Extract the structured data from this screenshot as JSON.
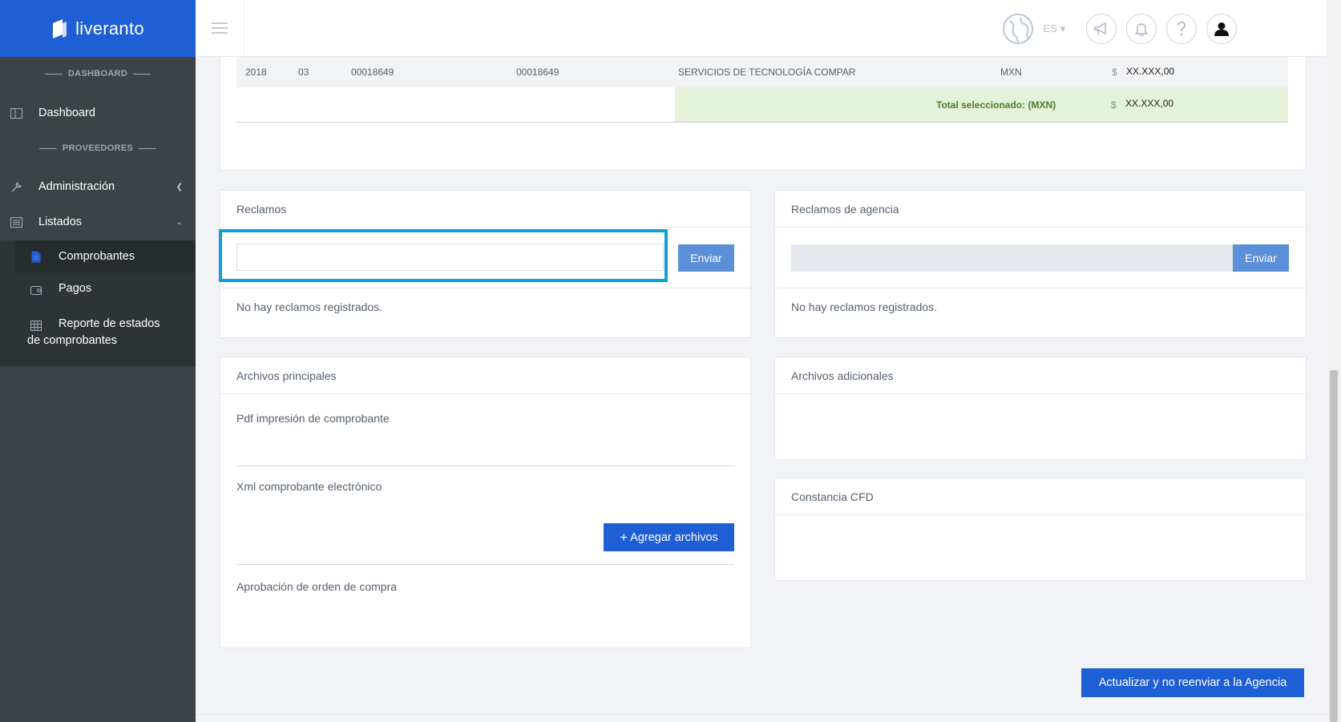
{
  "brand": {
    "name": "liveranto",
    "color": "#1f5fd6",
    "icon": "liveranto-logo-icon"
  },
  "sidebar": {
    "section_dashboard": "DASHBOARD",
    "section_proveedores": "PROVEEDORES",
    "items": [
      {
        "label": "Dashboard",
        "icon": "columns-icon"
      },
      {
        "label": "Administración",
        "icon": "wrench-icon"
      },
      {
        "label": "Listados",
        "icon": "list-icon"
      }
    ],
    "sub_items": [
      {
        "label": "Comprobantes",
        "icon": "document-icon",
        "active": true
      },
      {
        "label": "Pagos",
        "icon": "wallet-icon"
      },
      {
        "label": "Reporte de estados",
        "label2": "de comprobantes",
        "icon": "grid-icon"
      }
    ]
  },
  "topbar": {
    "language": "ES",
    "icons": [
      "globe-icon",
      "megaphone-icon",
      "bell-icon",
      "help-icon",
      "user-icon"
    ]
  },
  "table": {
    "row": {
      "year": "2018",
      "month": "03",
      "folio": "00018649",
      "folio2": "00018649",
      "provider": "SERVICIOS DE TECNOLOGÍA COMPAR",
      "currency": "MXN",
      "symbol": "$",
      "amount": "XX.XXX,00"
    },
    "total": {
      "label": "Total seleccionado: (MXN)",
      "symbol": "$",
      "amount": "XX.XXX,00"
    }
  },
  "reclamos": {
    "title": "Reclamos",
    "send_label": "Enviar",
    "empty_text": "No hay reclamos registrados.",
    "input_value": ""
  },
  "reclamos_agencia": {
    "title": "Reclamos de agencia",
    "send_label": "Enviar",
    "empty_text": "No hay reclamos registrados."
  },
  "archivos_principales": {
    "title": "Archivos principales",
    "pdf_label": "Pdf impresión de comprobante",
    "xml_label": "Xml comprobante electrónico",
    "add_files_label": "Agregar archivos",
    "approval_label": "Aprobación de orden de compra"
  },
  "archivos_adicionales": {
    "title": "Archivos adicionales"
  },
  "constancia": {
    "title": "Constancia CFD"
  },
  "actions": {
    "update_label": "Actualizar y no reenviar a la Agencia"
  },
  "colors": {
    "accent": "#1f5fd6",
    "sidebar": "#3b4346",
    "highlight": "#0f9ed8",
    "total_bg": "#e3f2d9"
  }
}
